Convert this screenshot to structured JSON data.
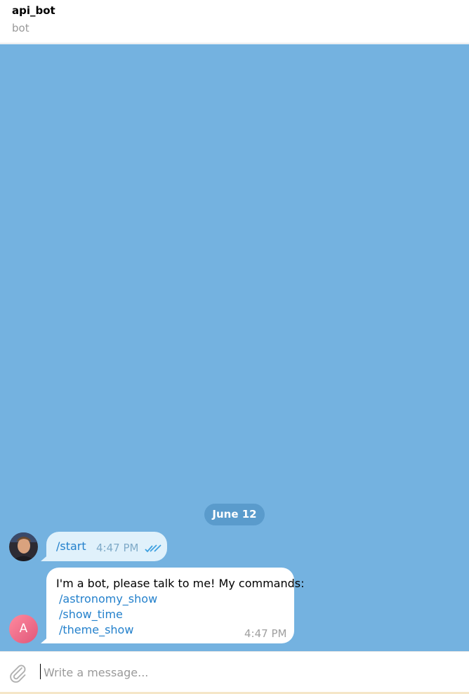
{
  "header": {
    "title": "api_bot",
    "subtitle": "bot"
  },
  "chat": {
    "date": "June 12",
    "outgoing": {
      "command": "/start",
      "time": "4:47 PM",
      "status_icon": "double-check-icon"
    },
    "incoming": {
      "avatar_letter": "A",
      "text": "I'm a bot, please talk to me! My commands:",
      "commands": [
        "/astronomy_show",
        "/show_time",
        "/theme_show"
      ],
      "time": "4:47 PM"
    }
  },
  "composer": {
    "placeholder": "Write a message...",
    "attach_icon": "paperclip-icon"
  },
  "colors": {
    "chat_background": "#74b2e0",
    "link": "#2481cc",
    "outgoing_bubble": "#e0f1fb"
  }
}
